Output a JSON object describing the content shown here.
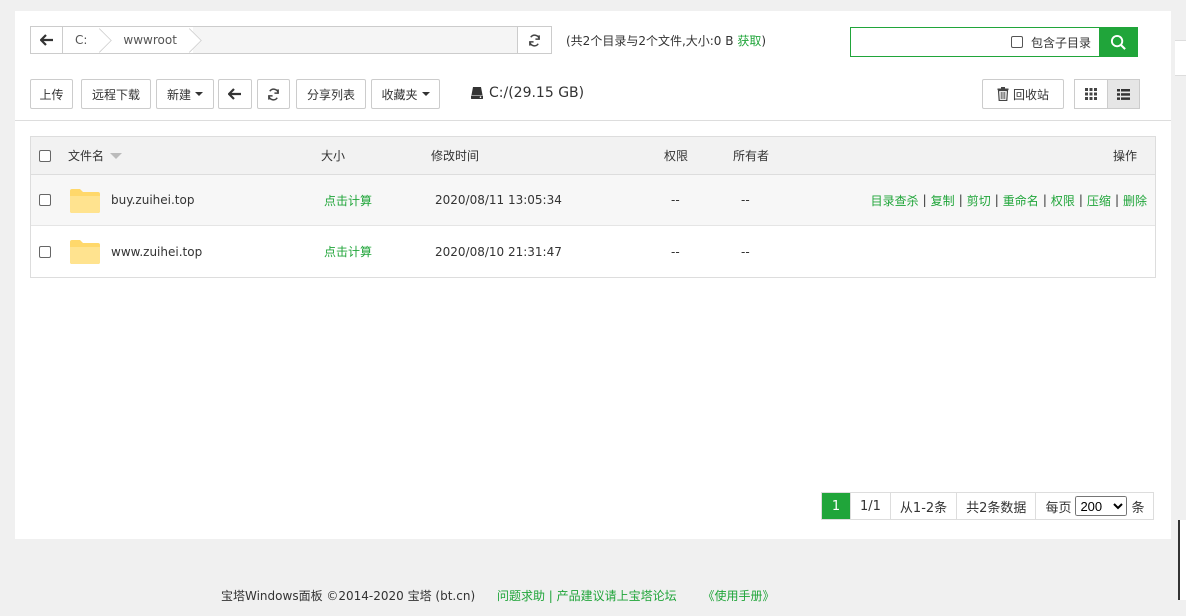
{
  "path": {
    "crumbs": [
      "C:",
      "wwwroot"
    ]
  },
  "summary": {
    "text": "(共2个目录与2个文件,大小:0 B",
    "link": "获取",
    "close": ")"
  },
  "search": {
    "value": "",
    "include_subdirs_label": "包含子目录"
  },
  "toolbar": {
    "upload": "上传",
    "remote_download": "远程下载",
    "new": "新建",
    "share_list": "分享列表",
    "favorites": "收藏夹",
    "disk": "C:/(29.15 GB)",
    "recycle_bin": "回收站"
  },
  "table": {
    "headers": {
      "name": "文件名",
      "size": "大小",
      "mtime": "修改时间",
      "perm": "权限",
      "owner": "所有者",
      "ops": "操作"
    },
    "rows": [
      {
        "name": "buy.zuihei.top",
        "size": "点击计算",
        "mtime": "2020/08/11 13:05:34",
        "perm": "--",
        "owner": "--",
        "ops": [
          "目录查杀",
          "复制",
          "剪切",
          "重命名",
          "权限",
          "压缩",
          "删除"
        ]
      },
      {
        "name": "www.zuihei.top",
        "size": "点击计算",
        "mtime": "2020/08/10 21:31:47",
        "perm": "--",
        "owner": "--",
        "ops": []
      }
    ]
  },
  "pager": {
    "current": "1",
    "pages": "1/1",
    "range": "从1-2条",
    "total": "共2条数据",
    "per_page_label": "每页",
    "per_page_value": "200",
    "unit": "条"
  },
  "footer": {
    "copyright": "宝塔Windows面板 ©2014-2020 宝塔 (bt.cn)",
    "help": "问题求助 | 产品建议请上宝塔论坛",
    "manual": "《使用手册》"
  },
  "colors": {
    "accent": "#20a53a"
  }
}
